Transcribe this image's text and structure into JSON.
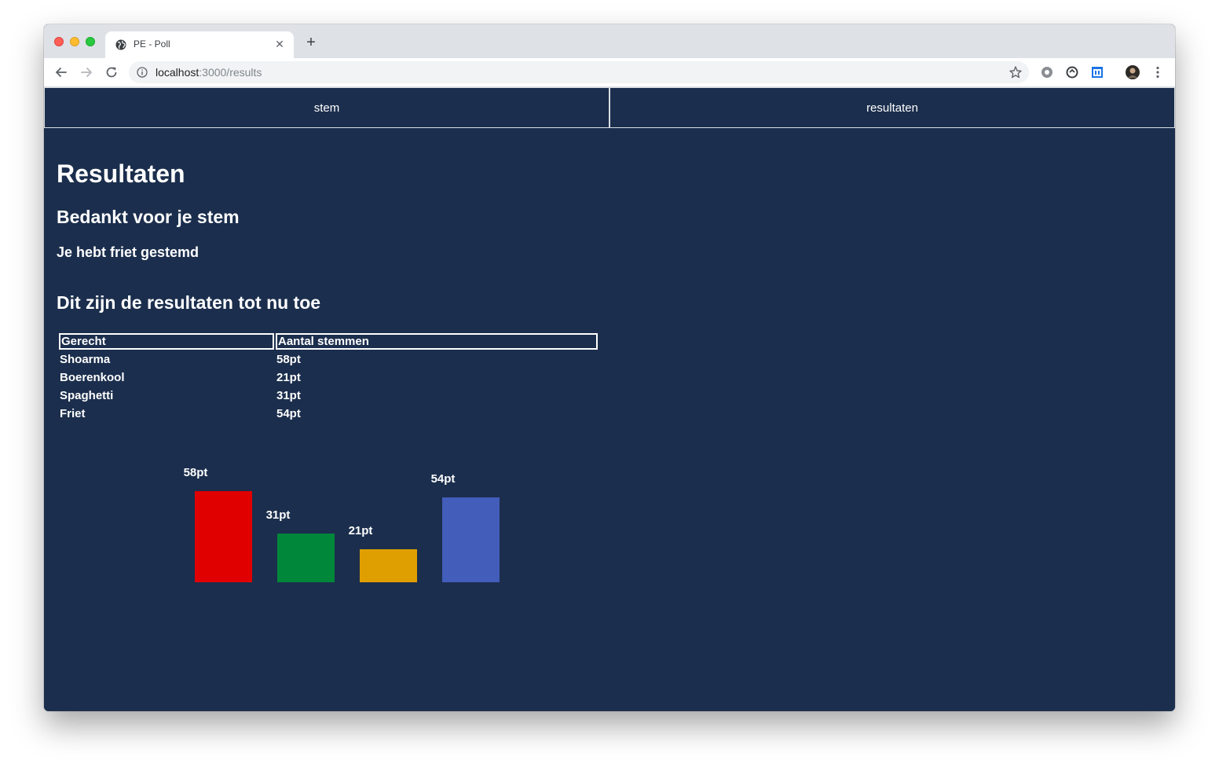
{
  "browser": {
    "tab_title": "PE - Poll",
    "url_host": "localhost",
    "url_path": ":3000/results"
  },
  "nav": {
    "items": [
      {
        "label": "stem"
      },
      {
        "label": "resultaten"
      }
    ]
  },
  "content": {
    "title": "Resultaten",
    "thanks": "Bedankt voor je stem",
    "voted": "Je hebt friet gestemd",
    "results_heading": "Dit zijn de resultaten tot nu toe"
  },
  "table": {
    "headers": [
      "Gerecht",
      "Aantal stemmen"
    ],
    "rows": [
      {
        "dish": "Shoarma",
        "votes": "58pt"
      },
      {
        "dish": "Boerenkool",
        "votes": "21pt"
      },
      {
        "dish": "Spaghetti",
        "votes": "31pt"
      },
      {
        "dish": "Friet",
        "votes": "54pt"
      }
    ]
  },
  "chart_data": {
    "type": "bar",
    "categories": [
      "Shoarma",
      "Spaghetti",
      "Boerenkool",
      "Friet"
    ],
    "values": [
      58,
      31,
      21,
      54
    ],
    "data_labels": [
      "58pt",
      "31pt",
      "21pt",
      "54pt"
    ],
    "colors": [
      "#e00000",
      "#00873a",
      "#e09f00",
      "#425dba"
    ],
    "title": "",
    "xlabel": "",
    "ylabel": "",
    "ylim": [
      0,
      58
    ]
  },
  "colors": {
    "page_bg": "#1b2e4d",
    "text": "#ffffff",
    "nav_border": "#d9dde3"
  }
}
